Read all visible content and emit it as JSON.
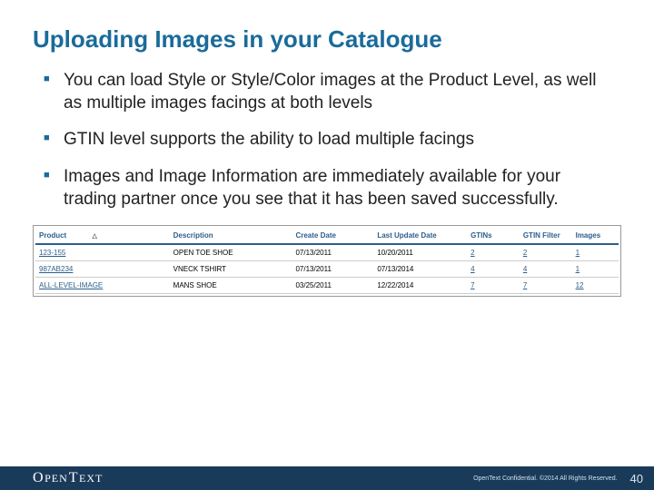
{
  "title": "Uploading Images in your Catalogue",
  "bullets": {
    "b1": "You can load Style or Style/Color images at the Product Level, as well as multiple images facings at both levels",
    "b2": "GTIN level supports the ability to load multiple facings",
    "b3": "Images and Image Information are immediately available for your trading partner once you see that it has been saved successfully."
  },
  "table": {
    "headers": {
      "product": "Product",
      "sort": "△",
      "description": "Description",
      "create_date": "Create Date",
      "last_update": "Last Update Date",
      "gtins": "GTINs",
      "gtin_filter": "GTIN Filter",
      "images": "Images"
    },
    "rows": [
      {
        "product": "123-155",
        "description": "OPEN TOE SHOE",
        "create_date": "07/13/2011",
        "last_update": "10/20/2011",
        "gtins": "2",
        "gtin_filter": "2",
        "images": "1"
      },
      {
        "product": "987AB234",
        "description": "VNECK TSHIRT",
        "create_date": "07/13/2011",
        "last_update": "07/13/2014",
        "gtins": "4",
        "gtin_filter": "4",
        "images": "1"
      },
      {
        "product": "ALL-LEVEL-IMAGE",
        "description": "MANS SHOE",
        "create_date": "03/25/2011",
        "last_update": "12/22/2014",
        "gtins": "7",
        "gtin_filter": "7",
        "images": "12"
      }
    ]
  },
  "footer": {
    "logo_open": "O",
    "logo_pen": "PEN",
    "logo_t": "T",
    "logo_ext": "EXT",
    "confidential": "OpenText Confidential. ©2014 All Rights Reserved.",
    "page": "40"
  }
}
